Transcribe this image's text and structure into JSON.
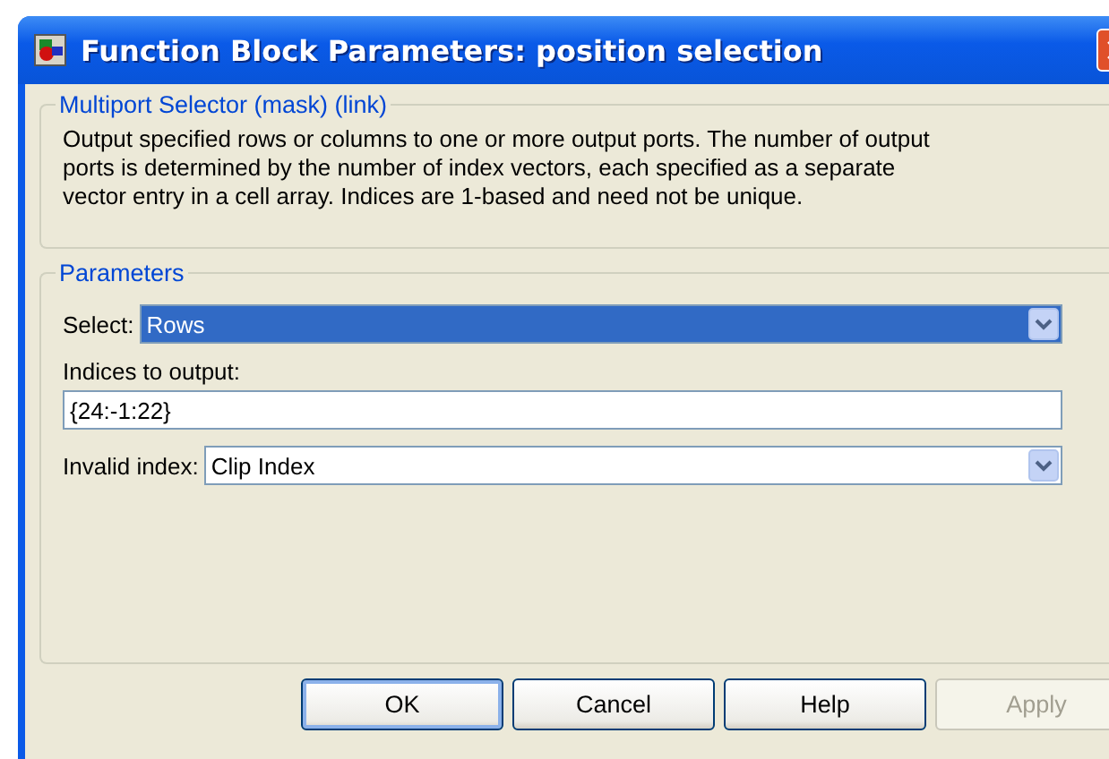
{
  "window": {
    "title": "Function Block Parameters: position selection"
  },
  "description": {
    "title": "Multiport Selector (mask) (link)",
    "text": "Output specified rows or columns to one or more output ports.  The number of output ports is determined by the number of index vectors, each specified as a separate vector entry in a cell array.  Indices are 1-based and need not be unique."
  },
  "parameters": {
    "title": "Parameters",
    "fields": [
      {
        "kind": "dropdown",
        "label": "Select:",
        "value": "Rows",
        "focused": true
      },
      {
        "kind": "text",
        "label": "Indices to output:",
        "value": "{24:-1:22}",
        "focused": false
      },
      {
        "kind": "dropdown",
        "label": "Invalid index:",
        "value": "Clip Index",
        "focused": false
      }
    ]
  },
  "buttons": [
    {
      "label": "OK",
      "default": true,
      "disabled": false
    },
    {
      "label": "Cancel",
      "default": false,
      "disabled": false
    },
    {
      "label": "Help",
      "default": false,
      "disabled": false
    },
    {
      "label": "Apply",
      "default": false,
      "disabled": true
    }
  ]
}
